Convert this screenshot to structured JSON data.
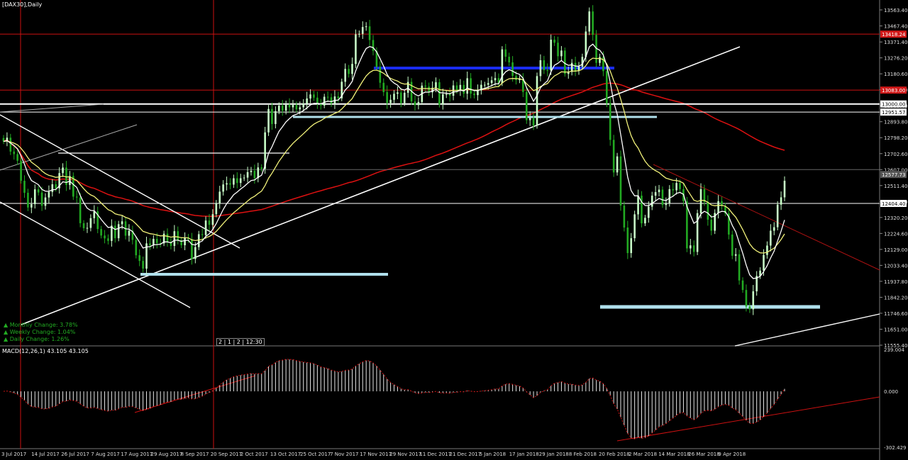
{
  "window": {
    "symbol_label": "[DAX30],Daily",
    "macd_label": "MACD(12,26,1) 43.105 43.105",
    "crosshair_box": "2 | 1 | 2 | 12:30"
  },
  "stats": [
    {
      "label": "Monthly Change: 3.78%"
    },
    {
      "label": "Weekly Change: 1.04%"
    },
    {
      "label": "Daily Change: 1.26%"
    }
  ],
  "colors": {
    "background": "#000000",
    "bull": "#c8ffc8",
    "bear": "#22aa22",
    "ema_fast": "#ffffff",
    "ema_mid": "#f2f27a",
    "sma_slow": "#dd1111",
    "support": "#b0e0ec",
    "resistance_blue": "#1a2cf0",
    "level_red": "#cc1111",
    "price_tag_red": "#d01818",
    "price_tag_white": "#ffffff",
    "stats_text": "#22aa22"
  },
  "price_axis": {
    "ticks": [
      "13563.40",
      "13467.40",
      "13371.40",
      "13276.20",
      "13180.60",
      "13085.00",
      "12989.40",
      "12893.80",
      "12798.20",
      "12702.60",
      "12607.00",
      "12511.40",
      "12415.80",
      "12320.20",
      "12224.60",
      "12129.00",
      "12033.40",
      "11937.80",
      "11842.20",
      "11746.60",
      "11651.00",
      "11555.40"
    ],
    "tags": [
      {
        "value": "13418.24",
        "style": "red"
      },
      {
        "value": "13083.00",
        "style": "red"
      },
      {
        "value": "13000.00",
        "style": "white"
      },
      {
        "value": "12951.57",
        "style": "white"
      },
      {
        "value": "12577.73",
        "style": "gray"
      },
      {
        "value": "12404.40",
        "style": "white"
      }
    ]
  },
  "macd_axis": {
    "ticks": [
      "239.004",
      "0.000",
      "-302.429"
    ]
  },
  "date_axis": {
    "labels": [
      "3 Jul 2017",
      "14 Jul 2017",
      "26 Jul 2017",
      "7 Aug 2017",
      "17 Aug 2017",
      "29 Aug 2017",
      "8 Sep 2017",
      "20 Sep 2017",
      "2 Oct 2017",
      "13 Oct 2017",
      "25 Oct 2017",
      "7 Nov 2017",
      "17 Nov 2017",
      "29 Nov 2017",
      "11 Dec 2017",
      "21 Dec 2017",
      "5 Jan 2018",
      "17 Jan 2018",
      "29 Jan 2018",
      "8 Feb 2018",
      "20 Feb 2018",
      "2 Mar 2018",
      "14 Mar 2018",
      "26 Mar 2018",
      "9 Apr 2018"
    ]
  },
  "chart_data": {
    "type": "candlestick",
    "instrument": "DAX30",
    "timeframe": "Daily",
    "price_range": [
      11555.4,
      13610
    ],
    "macd_range": [
      -302.429,
      239.004
    ],
    "closes": [
      12776,
      12798,
      12715,
      12700,
      12660,
      12540,
      12468,
      12380,
      12400,
      12489,
      12470,
      12390,
      12440,
      12473,
      12519,
      12495,
      12586,
      12619,
      12515,
      12568,
      12445,
      12440,
      12286,
      12256,
      12258,
      12316,
      12357,
      12251,
      12212,
      12195,
      12180,
      12271,
      12196,
      12280,
      12297,
      12211,
      12241,
      12186,
      12094,
      12060,
      12014,
      12165,
      12154,
      12192,
      12167,
      12165,
      12223,
      12174,
      12150,
      12238,
      12184,
      12154,
      12198,
      12190,
      12072,
      12143,
      12220,
      12215,
      12302,
      12276,
      12340,
      12404,
      12475,
      12518,
      12525,
      12517,
      12555,
      12527,
      12555,
      12559,
      12592,
      12600,
      12556,
      12620,
      12612,
      12830,
      12970,
      12880,
      12957,
      12990,
      12960,
      12995,
      12980,
      12994,
      12968,
      12980,
      13003,
      13033,
      13057,
      13038,
      13003,
      12991,
      13043,
      13040,
      13003,
      13045,
      13034,
      13133,
      13210,
      13180,
      13240,
      13417,
      13420,
      13461,
      13465,
      13383,
      13318,
      13222,
      13127,
      13071,
      13006,
      13025,
      13061,
      13069,
      13005,
      13067,
      13132,
      13015,
      12993,
      13012,
      13110,
      13104,
      13070,
      13097,
      13130,
      12997,
      13058,
      13059,
      13049,
      13111,
      13080,
      13114,
      13062,
      13154,
      13062,
      13053,
      13081,
      13115,
      13115,
      13125,
      13142,
      13155,
      13125,
      13327,
      13283,
      13249,
      13168,
      13143,
      13151,
      13072,
      12903,
      12917,
      12871,
      13167,
      13262,
      13203,
      13201,
      13385,
      13367,
      13286,
      13320,
      13180,
      13192,
      13246,
      13200,
      13224,
      13282,
      13434,
      13554,
      13414,
      13246,
      13281,
      13197,
      13004,
      12785,
      12590,
      12686,
      12392,
      12260,
      12107,
      12196,
      12339,
      12451,
      12285,
      12318,
      12385,
      12451,
      12472,
      12487,
      12395,
      12407,
      12490,
      12483,
      12527,
      12490,
      12418,
      12135,
      12153,
      12114,
      12346,
      12490,
      12413,
      12307,
      12241,
      12347,
      12418,
      12390,
      12345,
      12218,
      12091,
      12100,
      11943,
      11886,
      11787,
      11770,
      11878,
      11970,
      12002,
      12096,
      12152,
      12241,
      12262,
      12397,
      12441,
      12540
    ],
    "levels": [
      {
        "price": 13418.24,
        "kind": "resistance-red"
      },
      {
        "price": 13083.0,
        "kind": "resistance-red"
      },
      {
        "price": 13000.0,
        "kind": "round-number"
      },
      {
        "price": 12951.57,
        "kind": "white-line"
      },
      {
        "price": 12404.4,
        "kind": "white-line"
      }
    ],
    "macd_params": "12,26,1",
    "macd_value": 43.105
  }
}
